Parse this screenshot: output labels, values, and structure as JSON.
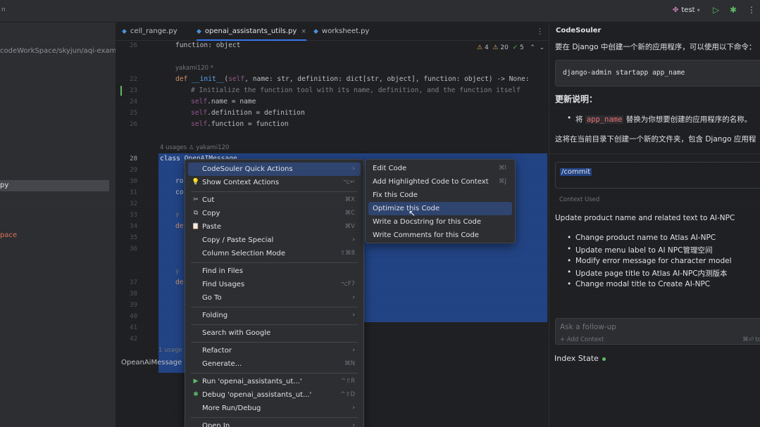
{
  "topbar": {
    "left_stub": "n",
    "run_config": "test",
    "colors": {
      "run": "#5fb865",
      "accent": "#3574f0"
    }
  },
  "project": {
    "path": "codeWorkSpace/skyjun/aqi-example",
    "selected_item": "py",
    "space_item": "pace"
  },
  "editor": {
    "tabs": [
      {
        "label": "cell_range.py",
        "active": false
      },
      {
        "label": "openai_assistants_utils.py",
        "active": true,
        "close": "×"
      },
      {
        "label": "worksheet.py",
        "active": false
      }
    ],
    "inspections": {
      "warnings": "4",
      "weak_warnings": "20",
      "ok": "5"
    },
    "lines": {
      "l26": "26",
      "l22": "22",
      "l23": "23",
      "l24": "24",
      "l25": "25",
      "l26b": "26",
      "l28": "28",
      "l29": "29",
      "l30": "30",
      "l31": "31",
      "l32": "32",
      "l33": "33",
      "l34": "34",
      "l35": "35",
      "l36": "36",
      "l37": "37",
      "l38": "38",
      "l39": "39",
      "l40": "40",
      "l41": "41",
      "l42": "42"
    },
    "code": {
      "line_function": "function: object",
      "author_hint_1": "yakami120 *",
      "def_kw": "def",
      "init": "__init__",
      "init_params_a": "(",
      "self1": "self",
      "init_params_b": ", name: str, definition: dict[str, object], function: object) -> None:",
      "comment": "# Initialize the function tool with its name, definition, and the function itself",
      "self_name": "self",
      "name_rest": ".name = name",
      "self_def": "self",
      "def_rest": ".definition = definition",
      "self_fn": "self",
      "fn_rest": ".function = function",
      "usages_hint": "4 usages  ♙ yakami120",
      "class_line": "class OpenAIMessage",
      "frag1": "rol",
      "frag2": "cor",
      "frag3": "y",
      "frag4": "def",
      "frag5": "y",
      "frag6": "def"
    },
    "bottom_usage": "1 usage",
    "breadcrumb": "OpeanAiMessage"
  },
  "context_menu": {
    "items": [
      {
        "label": "CodeSouler Quick Actions",
        "icon": "",
        "shortcut": "",
        "submenu": true,
        "highlighted": true
      },
      {
        "label": "Show Context Actions",
        "icon": "💡",
        "shortcut": "⌥↵",
        "submenu": false
      },
      {
        "sep": true
      },
      {
        "label": "Cut",
        "icon": "✂",
        "shortcut": "⌘X"
      },
      {
        "label": "Copy",
        "icon": "⧉",
        "shortcut": "⌘C"
      },
      {
        "label": "Paste",
        "icon": "📋",
        "shortcut": "⌘V"
      },
      {
        "label": "Copy / Paste Special",
        "submenu": true
      },
      {
        "label": "Column Selection Mode",
        "shortcut": "⇧⌘8"
      },
      {
        "sep": true
      },
      {
        "label": "Find in Files"
      },
      {
        "label": "Find Usages",
        "shortcut": "⌥F7"
      },
      {
        "label": "Go To",
        "submenu": true
      },
      {
        "sep": true
      },
      {
        "label": "Folding",
        "submenu": true
      },
      {
        "sep": true
      },
      {
        "label": "Search with Google"
      },
      {
        "sep": true
      },
      {
        "label": "Refactor",
        "submenu": true
      },
      {
        "label": "Generate...",
        "shortcut": "⌘N"
      },
      {
        "sep": true
      },
      {
        "label": "Run 'openai_assistants_ut...'",
        "icon": "▶",
        "icon_color": "green",
        "shortcut": "^⇧R"
      },
      {
        "label": "Debug 'openai_assistants_ut...'",
        "icon": "✱",
        "icon_color": "green",
        "shortcut": "^⇧D"
      },
      {
        "label": "More Run/Debug",
        "submenu": true
      },
      {
        "sep": true
      },
      {
        "label": "Open In",
        "submenu": true
      }
    ]
  },
  "submenu": {
    "items": [
      {
        "label": "Edit Code",
        "shortcut": "⌘I"
      },
      {
        "label": "Add Highlighted Code to Context",
        "shortcut": "⌘J"
      },
      {
        "label": "Fix this Code",
        "shortcut": ""
      },
      {
        "label": "Optimize this Code",
        "shortcut": "",
        "highlighted": true
      },
      {
        "label": "Write a Docstring for this Code",
        "shortcut": ""
      },
      {
        "label": "Write Comments for this Code",
        "shortcut": ""
      }
    ]
  },
  "right_panel": {
    "title": "CodeSouler",
    "intro": "要在 Django 中创建一个新的应用程序，可以使用以下命令：",
    "command": "django-admin startapp app_name",
    "update_heading": "更新说明：",
    "bullet1_pre": "将 ",
    "bullet1_code": "app_name",
    "bullet1_post": " 替换为你想要创建的应用程序的名称。",
    "note": "这将在当前目录下创建一个新的文件夹，包含 Django 应用程",
    "commit_tag": "/commit",
    "context_used": "Context Used",
    "summary": "Update product name and related text to AI-NPC",
    "changes": [
      "Change product name to Atlas AI-NPC",
      "Update menu label to AI NPC管理空间",
      "Modify error message for character model",
      "Update page title to Atlas AI-NPC内测版本",
      "Change modal title to Create AI-NPC"
    ],
    "followup_placeholder": "Ask a follow-up",
    "add_context": "+ Add Context",
    "send_hint": "⌘⏎ to",
    "index_state": "Index State"
  }
}
